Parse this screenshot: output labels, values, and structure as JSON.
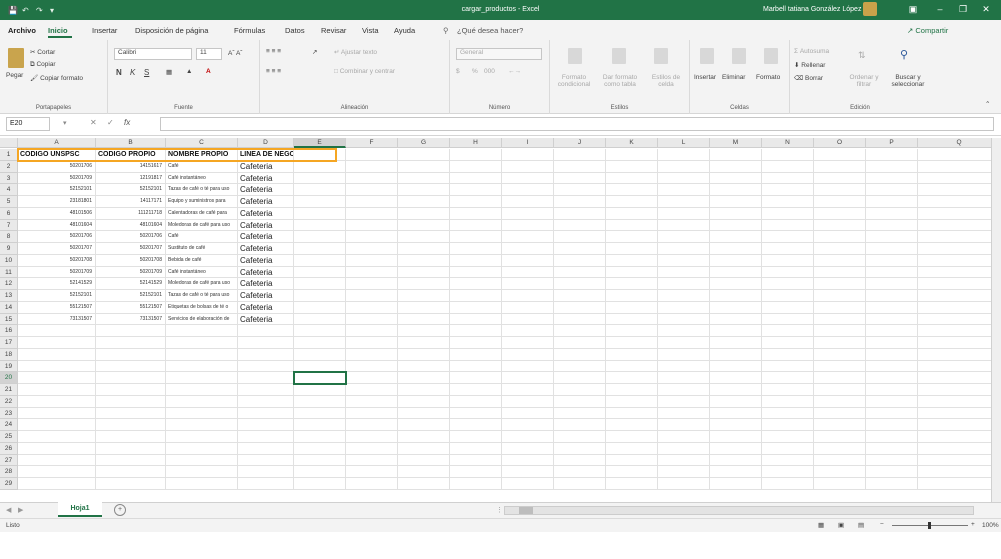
{
  "window": {
    "title": "cargar_productos  -  Excel",
    "user": "Marbell tatiana González López",
    "brand_color": "#217346",
    "quick_access": [
      "save-icon",
      "undo-icon",
      "redo-icon",
      "customize-icon"
    ]
  },
  "menu": {
    "tabs": [
      "Archivo",
      "Inicio",
      "Insertar",
      "Disposición de página",
      "Fórmulas",
      "Datos",
      "Revisar",
      "Vista",
      "Ayuda"
    ],
    "active_tab": "Inicio",
    "tell_me": "¿Qué desea hacer?",
    "share": "Compartir"
  },
  "ribbon": {
    "clipboard": {
      "paste": "Pegar",
      "cut": "Cortar",
      "copy": "Copiar",
      "format_painter": "Copiar formato",
      "label": "Portapapeles"
    },
    "font": {
      "name": "Calibri",
      "size": "11",
      "bold": "N",
      "italic": "K",
      "underline": "S",
      "label": "Fuente"
    },
    "alignment": {
      "wrap": "Ajustar texto",
      "merge": "Combinar y centrar",
      "label": "Alineación"
    },
    "number": {
      "format": "General",
      "percent": "%",
      "thousands": "000",
      "label": "Número"
    },
    "styles": {
      "conditional": "Formato condicional",
      "as_table": "Dar formato como tabla",
      "cell_styles": "Estilos de celda",
      "label": "Estilos"
    },
    "cells": {
      "insert": "Insertar",
      "delete": "Eliminar",
      "format": "Formato",
      "label": "Celdas"
    },
    "editing": {
      "autosum": "Autosuma",
      "fill": "Rellenar",
      "clear": "Borrar",
      "sort": "Ordenar y filtrar",
      "find": "Buscar y seleccionar",
      "label": "Edición"
    }
  },
  "formula_bar": {
    "name_box": "E20",
    "fx": "fx",
    "formula": ""
  },
  "columns": [
    "A",
    "B",
    "C",
    "D",
    "E",
    "F",
    "G",
    "H",
    "I",
    "J",
    "K",
    "L",
    "M",
    "N",
    "O",
    "P",
    "Q"
  ],
  "rows": [
    "1",
    "2",
    "3",
    "4",
    "5",
    "6",
    "7",
    "8",
    "9",
    "10",
    "11",
    "12",
    "13",
    "14",
    "15",
    "16",
    "17",
    "18",
    "19",
    "20",
    "21",
    "22",
    "23",
    "24",
    "25",
    "26",
    "27",
    "28",
    "29"
  ],
  "headers": [
    "CODIGO UNSPSC",
    "CODIGO PROPIO",
    "NOMBRE PROPIO",
    "LINEA DE NEGOCIOS"
  ],
  "data": [
    [
      "50201706",
      "14151617",
      "Café",
      "Cafeteria"
    ],
    [
      "50201709",
      "12191817",
      "Café instantáneo",
      "Cafeteria"
    ],
    [
      "52152101",
      "52152101",
      "Tazas de café o té para uso",
      "Cafeteria"
    ],
    [
      "23181801",
      "14117171",
      "Equipo y suministros para",
      "Cafeteria"
    ],
    [
      "48101506",
      "111211718",
      "Calentadoras de café para",
      "Cafeteria"
    ],
    [
      "48101604",
      "48101604",
      "Moledoras de café para uso",
      "Cafeteria"
    ],
    [
      "50201706",
      "50201706",
      "Café",
      "Cafeteria"
    ],
    [
      "50201707",
      "50201707",
      "Sustituto de café",
      "Cafeteria"
    ],
    [
      "50201708",
      "50201708",
      "Bebida de café",
      "Cafeteria"
    ],
    [
      "50201709",
      "50201709",
      "Café instantáneo",
      "Cafeteria"
    ],
    [
      "52141529",
      "52141529",
      "Moledoras de café para uso",
      "Cafeteria"
    ],
    [
      "52152101",
      "52152101",
      "Tazas de café o té para uso",
      "Cafeteria"
    ],
    [
      "55121507",
      "55121507",
      "Etiquetas de bolsas de té o",
      "Cafeteria"
    ],
    [
      "73131507",
      "73131507",
      "Servicios de elaboración de",
      "Cafeteria"
    ]
  ],
  "sheet": {
    "name": "Hoja1",
    "add": "+"
  },
  "status": {
    "mode": "Listo",
    "zoom": "100%",
    "zoom_minus": "−",
    "zoom_plus": "+"
  }
}
